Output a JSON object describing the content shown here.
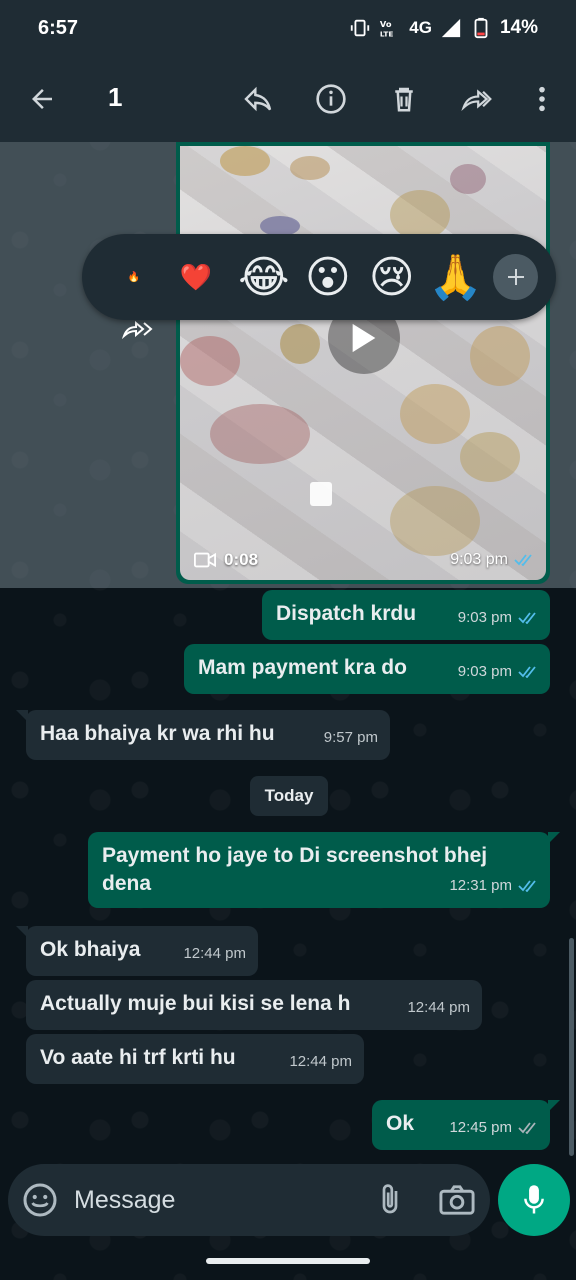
{
  "status_bar": {
    "time": "6:57",
    "network": "4G",
    "battery": "14%"
  },
  "toolbar": {
    "selected_count": "1"
  },
  "media_message": {
    "duration": "0:08",
    "time": "9:03 pm"
  },
  "reactions": [
    "🔥",
    "❤️",
    "😂",
    "😮",
    "😢",
    "🙏"
  ],
  "messages": [
    {
      "dir": "out",
      "text": "Dispatch krdu",
      "time": "9:03 pm"
    },
    {
      "dir": "out",
      "text": "Mam payment kra do",
      "time": "9:03 pm"
    },
    {
      "dir": "in",
      "text": "Haa bhaiya kr wa rhi hu",
      "time": "9:57 pm"
    },
    {
      "dir": "out",
      "text": "Payment ho jaye to Di screenshot bhej dena",
      "time": "12:31 pm"
    },
    {
      "dir": "in",
      "text": "Ok bhaiya",
      "time": "12:44 pm"
    },
    {
      "dir": "in",
      "text": "Actually muje bui kisi se lena h",
      "time": "12:44 pm"
    },
    {
      "dir": "in",
      "text": "Vo aate hi trf krti hu",
      "time": "12:44 pm"
    },
    {
      "dir": "out",
      "text": "Ok",
      "time": "12:45 pm"
    }
  ],
  "date_divider": "Today",
  "input": {
    "placeholder": "Message"
  },
  "colors": {
    "outgoing_bubble": "#005c4b",
    "incoming_bubble": "#1f2c34",
    "background": "#0b141a",
    "accent": "#00a884",
    "read_ticks": "#53bdeb"
  }
}
